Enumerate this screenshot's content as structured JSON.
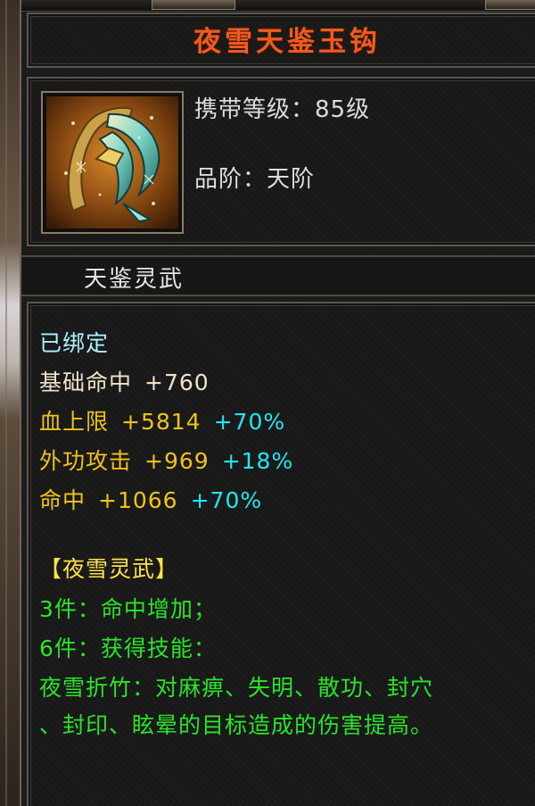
{
  "item": {
    "name": "夜雪天鉴玉钩",
    "required_level_label": "携带等级：",
    "required_level_value": "85级",
    "grade_label": "品阶：",
    "grade_value": "天阶",
    "icon": "jade-hook-weapon-icon"
  },
  "set_name": "天鉴灵武",
  "bind_status": "已绑定",
  "stats": [
    {
      "label": "基础命中",
      "value": "+760",
      "bonus": ""
    },
    {
      "label": "血上限",
      "value": "+5814",
      "bonus": "+70%"
    },
    {
      "label": "外功攻击",
      "value": "+969",
      "bonus": "+18%"
    },
    {
      "label": "命中",
      "value": "+1066",
      "bonus": "+70%"
    }
  ],
  "set_bonus": {
    "title": "【夜雪灵武】",
    "lines": [
      "3件：命中增加；",
      "6件：获得技能：",
      "夜雪折竹：对麻痹、失明、散功、封穴",
      "、封印、眩晕的目标造成的伤害提高。"
    ]
  },
  "colors": {
    "title": "#ef5b1f",
    "stat_yellow": "#f0c316",
    "bonus_cyan": "#22e7ee",
    "set_green": "#29e52a",
    "bind_cyan": "#aef1ff"
  }
}
